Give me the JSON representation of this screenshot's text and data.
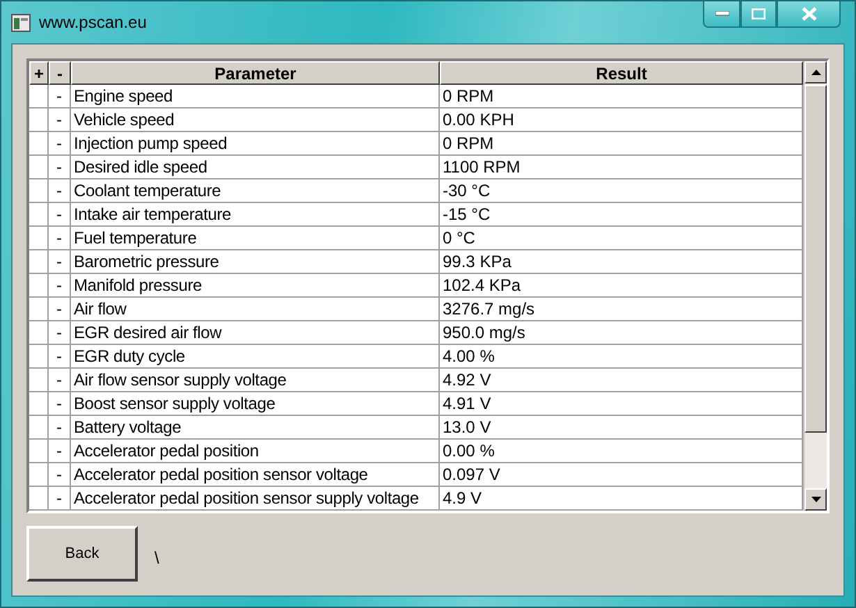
{
  "window": {
    "title": "www.pscan.eu"
  },
  "table": {
    "columns": [
      "+",
      "-",
      "Parameter",
      "Result"
    ],
    "rows": [
      {
        "toggle": "-",
        "parameter": "Engine speed",
        "result": "0 RPM"
      },
      {
        "toggle": "-",
        "parameter": "Vehicle speed",
        "result": "0.00 KPH"
      },
      {
        "toggle": "-",
        "parameter": "Injection pump speed",
        "result": "0 RPM"
      },
      {
        "toggle": "-",
        "parameter": "Desired idle speed",
        "result": "1100 RPM"
      },
      {
        "toggle": "-",
        "parameter": "Coolant temperature",
        "result": "-30 °C"
      },
      {
        "toggle": "-",
        "parameter": "Intake air temperature",
        "result": "-15 °C"
      },
      {
        "toggle": "-",
        "parameter": "Fuel temperature",
        "result": "0 °C"
      },
      {
        "toggle": "-",
        "parameter": "Barometric pressure",
        "result": "99.3 KPa"
      },
      {
        "toggle": "-",
        "parameter": "Manifold pressure",
        "result": "102.4 KPa"
      },
      {
        "toggle": "-",
        "parameter": "Air flow",
        "result": "3276.7 mg/s"
      },
      {
        "toggle": "-",
        "parameter": "EGR desired air flow",
        "result": "950.0 mg/s"
      },
      {
        "toggle": "-",
        "parameter": "EGR duty cycle",
        "result": "4.00 %"
      },
      {
        "toggle": "-",
        "parameter": "Air flow sensor supply voltage",
        "result": "4.92 V"
      },
      {
        "toggle": "-",
        "parameter": "Boost sensor supply voltage",
        "result": "4.91 V"
      },
      {
        "toggle": "-",
        "parameter": "Battery voltage",
        "result": "13.0 V"
      },
      {
        "toggle": "-",
        "parameter": "Accelerator pedal position",
        "result": "0.00 %"
      },
      {
        "toggle": "-",
        "parameter": "Accelerator pedal position sensor voltage",
        "result": "0.097 V"
      },
      {
        "toggle": "-",
        "parameter": "Accelerator pedal position sensor supply voltage",
        "result": "4.9 V"
      }
    ]
  },
  "back_button": "Back",
  "status_text": "\\"
}
